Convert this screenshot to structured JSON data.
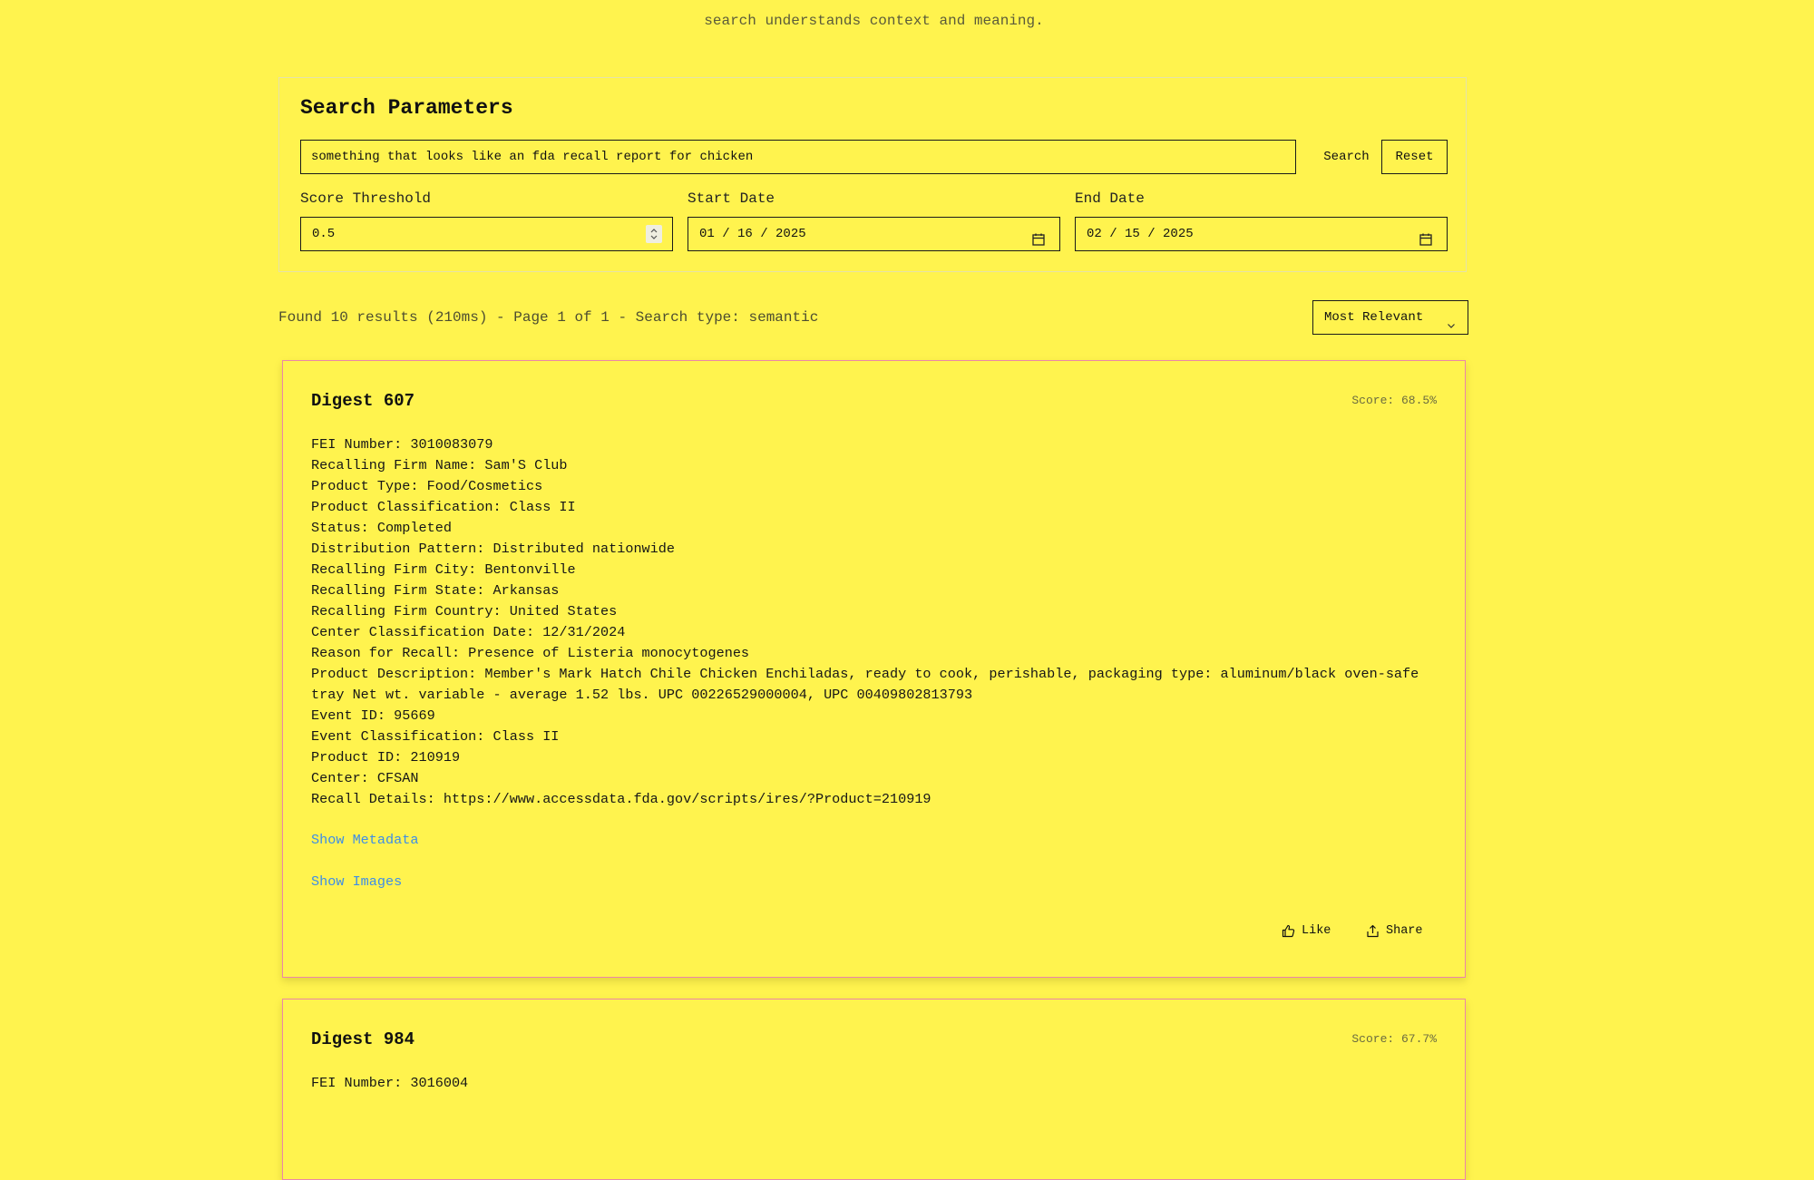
{
  "tagline": "search understands context and meaning.",
  "search": {
    "title": "Search Parameters",
    "query": "something that looks like an fda recall report for chicken",
    "search_label": "Search",
    "reset_label": "Reset",
    "score_label": "Score Threshold",
    "score_value": "0.5",
    "start_label": "Start Date",
    "start_value": "01 / 16 / 2025",
    "end_label": "End Date",
    "end_value": "02 / 15 / 2025"
  },
  "results": {
    "status": "Found 10 results (210ms) - Page 1 of 1 - Search type: semantic",
    "sort_value": "Most Relevant"
  },
  "cards": [
    {
      "title": "Digest 607",
      "score": "Score: 68.5%",
      "lines": [
        "FEI Number: 3010083079",
        "Recalling Firm Name: Sam'S Club",
        "Product Type: Food/Cosmetics",
        "Product Classification: Class II",
        "Status: Completed",
        "Distribution Pattern: Distributed nationwide",
        "Recalling Firm City: Bentonville",
        "Recalling Firm State: Arkansas",
        "Recalling Firm Country: United States",
        "Center Classification Date: 12/31/2024",
        "Reason for Recall: Presence of Listeria monocytogenes",
        "Product Description: Member's Mark Hatch Chile Chicken Enchiladas, ready to cook, perishable, packaging type: aluminum/black oven-safe tray Net wt. variable - average 1.52 lbs. UPC 00226529000004, UPC 00409802813793",
        "Event ID: 95669",
        "Event Classification: Class II",
        "Product ID: 210919",
        "Center: CFSAN",
        "Recall Details: https://www.accessdata.fda.gov/scripts/ires/?Product=210919"
      ],
      "show_metadata": "Show Metadata",
      "show_images": "Show Images",
      "like_label": "Like",
      "share_label": "Share"
    },
    {
      "title": "Digest 984",
      "score": "Score: 67.7%",
      "lines": [
        "FEI Number: 3016004"
      ]
    }
  ]
}
